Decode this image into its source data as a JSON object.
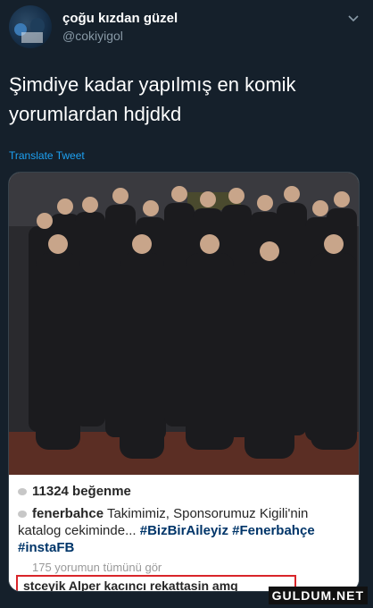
{
  "header": {
    "display_name": "çoğu kızdan güzel",
    "handle": "@cokiyigol"
  },
  "tweet": {
    "text": "Şimdiye kadar yapılmış en komik yorumlardan hdjdkd",
    "translate_label": "Translate Tweet"
  },
  "instagram_post": {
    "likes": "11324 beğenme",
    "caption_user": "fenerbahce",
    "caption_text": "Takimimiz, Sponsorumuz Kigili'nin katalog cekiminde...",
    "caption_tags": "#BizBirAileyiz #Fenerbahçe #instaFB",
    "view_all_comments": "175 yorumun tümünü gör",
    "highlighted_comment": "stceyik Alper kacıncı rekattasin amq"
  },
  "watermark": {
    "text": "GULDUM.NET"
  },
  "colors": {
    "background": "#15202b",
    "link": "#1da1f2",
    "handle": "#8899a6",
    "highlight_border": "#d9252a"
  }
}
